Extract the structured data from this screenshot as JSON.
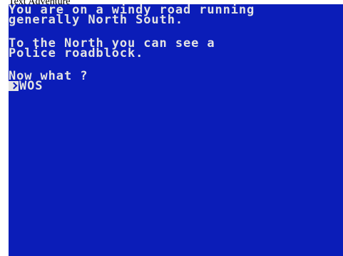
{
  "window": {
    "title": "Text Adventure"
  },
  "screen": {
    "lines": [
      "You are on a windy road running",
      "generally North South.",
      "To the North you can see a",
      "Police roadblock.",
      "Now what ?"
    ],
    "input": {
      "cursor_icon": "cursor-arrow-icon",
      "typed_text": "WOS"
    },
    "colors": {
      "background": "#0b1db8",
      "text": "#e4e4e4"
    }
  }
}
